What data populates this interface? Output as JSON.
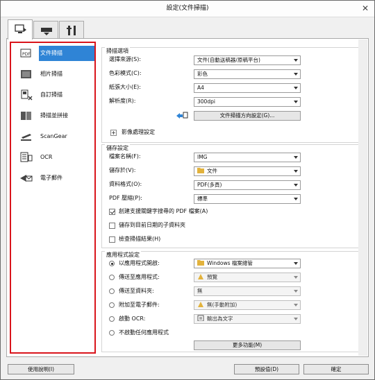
{
  "window": {
    "title": "設定(文件掃描)"
  },
  "tabs": [
    {
      "name": "scan-from-computer",
      "active": true
    },
    {
      "name": "scan-from-panel",
      "active": false
    },
    {
      "name": "general-settings",
      "active": false
    }
  ],
  "nav": [
    {
      "label": "文件掃描",
      "icon": "document-scan-icon",
      "selected": true
    },
    {
      "label": "相片掃描",
      "icon": "photo-scan-icon",
      "selected": false
    },
    {
      "label": "自訂掃描",
      "icon": "custom-scan-icon",
      "selected": false
    },
    {
      "label": "掃描並拼接",
      "icon": "scan-stitch-icon",
      "selected": false
    },
    {
      "label": "ScanGear",
      "icon": "scangear-icon",
      "selected": false
    },
    {
      "label": "OCR",
      "icon": "ocr-icon",
      "selected": false
    },
    {
      "label": "電子郵件",
      "icon": "email-icon",
      "selected": false
    }
  ],
  "scan_options": {
    "title": "掃描選項",
    "source_label": "選擇來源(S):",
    "source_value": "文件(自動送稿器/原稿平台)",
    "color_label": "色彩模式(C):",
    "color_value": "彩色",
    "paper_label": "紙張大小(E):",
    "paper_value": "A4",
    "resolution_label": "解析度(R):",
    "resolution_value": "300dpi",
    "orientation_button": "文件掃描方向設定(G)...",
    "image_processing": "影像處理設定"
  },
  "save_settings": {
    "title": "儲存設定",
    "filename_label": "檔案名稱(F):",
    "filename_value": "IMG",
    "savein_label": "儲存於(V):",
    "savein_value": "文件",
    "format_label": "資料格式(O):",
    "format_value": "PDF(多頁)",
    "compression_label": "PDF 壓縮(P):",
    "compression_value": "標準",
    "check_searchable": "創建支援關鍵字搜尋的 PDF 檔案(A)",
    "check_subfolder": "儲存到目前日期的子資料夾",
    "check_results": "檢查掃描結果(H)"
  },
  "app_settings": {
    "title": "應用程式設定",
    "opt_open": "以應用程式開啟:",
    "opt_open_value": "Windows 檔案總管",
    "opt_send_app": "傳送至應用程式:",
    "opt_send_app_value": "預覽",
    "opt_send_folder": "傳送至資料夾:",
    "opt_send_folder_value": "無",
    "opt_email": "附加至電子郵件:",
    "opt_email_value": "無(手動附加)",
    "opt_ocr": "啟動 OCR:",
    "opt_ocr_value": "輸出為文字",
    "opt_none": "不啟動任何應用程式",
    "more_functions": "更多功能(M)"
  },
  "footer": {
    "help": "使用說明(I)",
    "defaults": "預設值(D)",
    "ok": "確定"
  },
  "colors": {
    "accent": "#2f84d6",
    "highlight_border": "#d9141b"
  }
}
